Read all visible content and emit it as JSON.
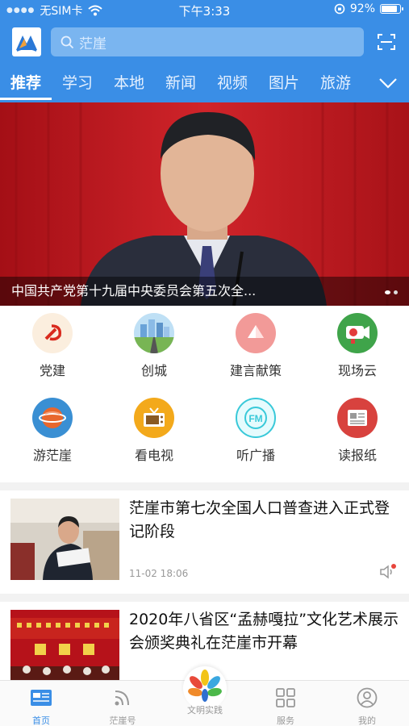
{
  "status_bar": {
    "carrier": "无SIM卡",
    "time": "下午3:33",
    "battery": "92%"
  },
  "search": {
    "placeholder": "茫崖"
  },
  "tabs": [
    "推荐",
    "学习",
    "本地",
    "新闻",
    "视频",
    "图片",
    "旅游"
  ],
  "active_tab": "推荐",
  "hero": {
    "caption": "中国共产党第十九届中央委员会第五次全..."
  },
  "grid": [
    {
      "label": "党建",
      "icon": "party-emblem-icon"
    },
    {
      "label": "创城",
      "icon": "city-road-icon"
    },
    {
      "label": "建言献策",
      "icon": "paper-plane-icon"
    },
    {
      "label": "现场云",
      "icon": "camera-icon"
    },
    {
      "label": "游茫崖",
      "icon": "globe-icon"
    },
    {
      "label": "看电视",
      "icon": "tv-icon"
    },
    {
      "label": "听广播",
      "icon": "radio-fm-icon"
    },
    {
      "label": "读报纸",
      "icon": "newspaper-icon"
    }
  ],
  "news": [
    {
      "title": "茫崖市第七次全国人口普查进入正式登记阶段",
      "time": "11-02 18:06"
    },
    {
      "title": "2020年八省区“孟赫嘎拉”文化艺术展示会颁奖典礼在茫崖市开幕",
      "time": ""
    }
  ],
  "bottom_nav": [
    {
      "label": "首页",
      "icon": "home-icon"
    },
    {
      "label": "茫崖号",
      "icon": "rss-icon"
    },
    {
      "label": "文明实践",
      "icon": "flower-logo-icon"
    },
    {
      "label": "服务",
      "icon": "grid-icon"
    },
    {
      "label": "我的",
      "icon": "user-icon"
    }
  ],
  "colors": {
    "brand_blue": "#3a8ee6",
    "hero_red": "#b3141b"
  }
}
